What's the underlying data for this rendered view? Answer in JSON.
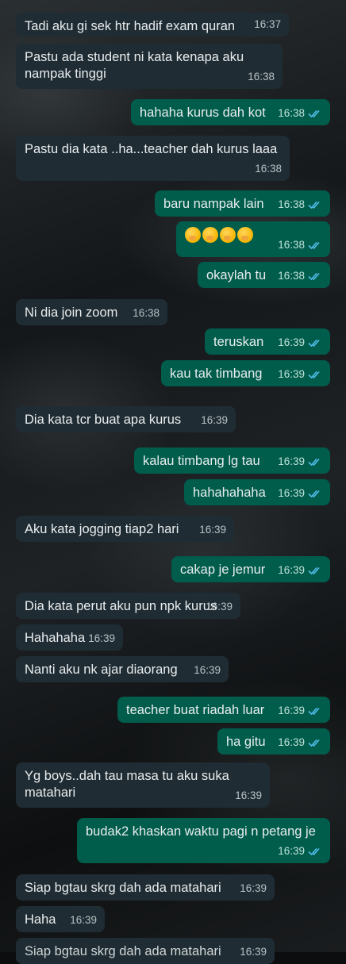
{
  "messages": [
    {
      "dir": "in",
      "text": "Tadi aku gi sek htr hadif exam quran",
      "time": "16:37"
    },
    {
      "dir": "in",
      "text": "Pastu ada student ni kata kenapa aku\nnampak tinggi",
      "time": "16:38"
    },
    {
      "dir": "out",
      "text": "hahaha kurus dah kot",
      "time": "16:38"
    },
    {
      "dir": "in",
      "text": "Pastu dia kata ..ha...teacher dah kurus laaa",
      "time": "16:38"
    },
    {
      "dir": "out",
      "text": "baru nampak lain",
      "time": "16:38"
    },
    {
      "dir": "out",
      "text": "🤭🤭🤭🤭",
      "time": "16:38",
      "emoji": 4
    },
    {
      "dir": "out",
      "text": "okaylah tu",
      "time": "16:38"
    },
    {
      "dir": "in",
      "text": "Ni dia join zoom",
      "time": "16:38"
    },
    {
      "dir": "out",
      "text": "teruskan",
      "time": "16:39"
    },
    {
      "dir": "out",
      "text": "kau tak timbang",
      "time": "16:39"
    },
    {
      "dir": "in",
      "text": "Dia kata tcr buat apa kurus",
      "time": "16:39"
    },
    {
      "dir": "out",
      "text": "kalau timbang lg tau",
      "time": "16:39"
    },
    {
      "dir": "out",
      "text": "hahahahaha",
      "time": "16:39"
    },
    {
      "dir": "in",
      "text": "Aku kata jogging tiap2 hari",
      "time": "16:39"
    },
    {
      "dir": "out",
      "text": "cakap je jemur",
      "time": "16:39"
    },
    {
      "dir": "in",
      "text": "Dia kata perut aku pun npk kurus",
      "time": "16:39"
    },
    {
      "dir": "in",
      "text": "Hahahaha",
      "time": "16:39"
    },
    {
      "dir": "in",
      "text": "Nanti aku nk ajar diaorang",
      "time": "16:39"
    },
    {
      "dir": "out",
      "text": "teacher buat riadah luar",
      "time": "16:39"
    },
    {
      "dir": "out",
      "text": "ha gitu",
      "time": "16:39"
    },
    {
      "dir": "in",
      "text": "Yg boys..dah tau masa tu aku suka\nmatahari",
      "time": "16:39"
    },
    {
      "dir": "out",
      "text": "budak2 khaskan waktu pagi n petang je",
      "time": "16:39"
    },
    {
      "dir": "in",
      "text": "Siap bgtau skrg dah ada matahari",
      "time": "16:39"
    },
    {
      "dir": "in",
      "text": "Haha",
      "time": "16:39"
    },
    {
      "dir": "in",
      "text": "Siap bgtau skrg dah ada matahari",
      "time": "16:39",
      "cut": true
    }
  ],
  "colors": {
    "incoming": "#1f2c33",
    "outgoing": "#005c4b",
    "read_tick": "#53bdeb"
  }
}
